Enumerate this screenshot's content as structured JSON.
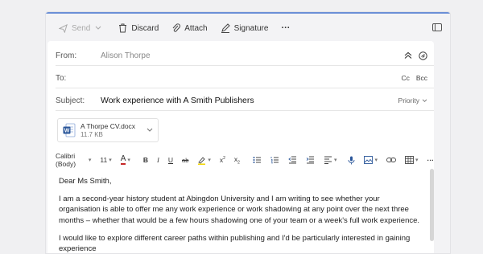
{
  "toolbar": {
    "send": "Send",
    "discard": "Discard",
    "attach": "Attach",
    "signature": "Signature",
    "more": "···"
  },
  "fields": {
    "from_label": "From:",
    "from_value": "Alison Thorpe",
    "to_label": "To:",
    "cc": "Cc",
    "bcc": "Bcc",
    "subject_label": "Subject:",
    "subject_value": "Work experience with A Smith Publishers",
    "priority": "Priority"
  },
  "attachment": {
    "name": "A Thorpe CV.docx",
    "size": "11.7 KB"
  },
  "format": {
    "font": "Calibri (Body)",
    "size": "11",
    "text_color": "#c62828",
    "highlight_color": "#f2d600"
  },
  "body": {
    "greeting": "Dear Ms Smith,",
    "para1": "I am a second-year history student at Abingdon University and I am writing to see whether your organisation is able to offer me any work experience or work shadowing at any point over the next three months – whether that would be a few hours shadowing one of your team or a week's full work experience.",
    "para2": "I would like to explore different career paths within publishing and I'd be particularly interested in gaining experience"
  },
  "colors": {
    "accent": "#6b8fd6",
    "word_blue": "#2b579a"
  }
}
